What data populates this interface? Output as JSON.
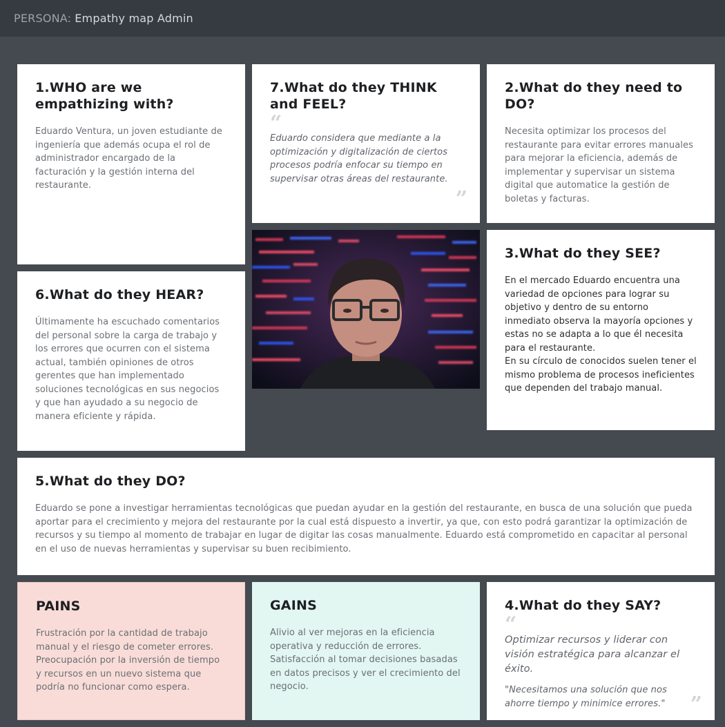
{
  "header": {
    "prefix": "PERSONA:",
    "title": "Empathy map Admin"
  },
  "cards": {
    "who": {
      "title": "1.WHO are we empathizing with?",
      "text": "Eduardo Ventura, un joven estudiante de ingeniería que además ocupa el rol de administrador encargado de la facturación y la gestión interna del restaurante."
    },
    "think": {
      "title": "7.What do they THINK and FEEL?",
      "quote": "Eduardo considera que mediante a la optimización y digitalización de ciertos procesos podría enfocar su tiempo en supervisar otras áreas del restaurante."
    },
    "need": {
      "title": "2.What do they need to DO?",
      "text": "Necesita optimizar los procesos del restaurante para evitar errores manuales para mejorar la eficiencia, además de implementar y supervisar un sistema digital que automatice la gestión de boletas y facturas."
    },
    "hear": {
      "title": "6.What do they HEAR?",
      "text": "Últimamente ha escuchado comentarios del personal sobre la carga de trabajo y los errores que ocurren con el sistema actual, también opiniones de otros gerentes que han implementado soluciones tecnológicas en sus negocios y que han ayudado a su negocio de manera eficiente y rápida."
    },
    "see": {
      "title": "3.What do they SEE?",
      "text1": "En el mercado Eduardo encuentra una variedad de opciones para lograr su objetivo y dentro de su entorno inmediato observa la mayoría opciones y estas no se adapta a lo que él necesita para el restaurante.",
      "text2": "En su círculo de conocidos suelen tener el mismo problema de procesos ineficientes que dependen del trabajo manual."
    },
    "do": {
      "title": "5.What do they DO?",
      "text": "Eduardo se pone a investigar herramientas tecnológicas que puedan ayudar en la gestión del restaurante, en busca de una solución que pueda aportar para el crecimiento y mejora del restaurante por la cual está dispuesto a invertir, ya que, con esto podrá garantizar la optimización de recursos y su tiempo al momento de trabajar en lugar de digitar las cosas manualmente. Eduardo está comprometido en capacitar al personal en el uso de nuevas herramientas y supervisar su buen recibimiento."
    },
    "pains": {
      "title": "PAINS",
      "text": "Frustración por la cantidad de trabajo manual y el riesgo de cometer errores. Preocupación por la inversión de tiempo y recursos en un nuevo sistema que podría no funcionar como espera."
    },
    "gains": {
      "title": "GAINS",
      "text": " Alivio al ver mejoras en la eficiencia operativa y reducción de errores. Satisfacción al tomar decisiones basadas en datos precisos y ver el crecimiento del negocio."
    },
    "say": {
      "title": "4.What do they SAY?",
      "quote1": "Optimizar recursos y liderar con visión estratégica para alcanzar el éxito.",
      "quote2": "\"Necesitamos una solución que nos ahorre tiempo y minimice errores.\""
    }
  },
  "quote_marks": {
    "open": "“",
    "close": "”"
  },
  "colors": {
    "background": "#454950",
    "topbar": "#363a41",
    "pains": "#f9dcd8",
    "gains": "#e2f6f2"
  },
  "photo": {
    "icon": "persona-photo"
  }
}
